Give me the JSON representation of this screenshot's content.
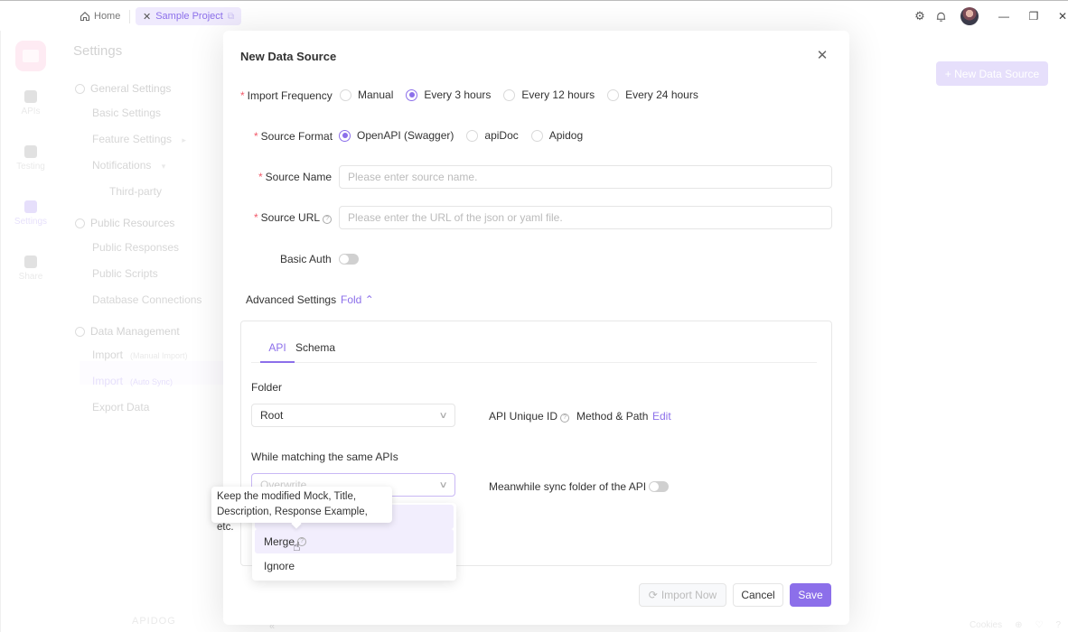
{
  "titlebar": {
    "home_label": "Home",
    "project_tab_label": "Sample Project",
    "icons": [
      "settings-icon",
      "bell-icon",
      "avatar",
      "minimize-icon",
      "restore-icon",
      "close-icon"
    ]
  },
  "rail": {
    "items": [
      {
        "label": "APIs",
        "icon": "apis-icon"
      },
      {
        "label": "Testing",
        "icon": "testing-icon"
      },
      {
        "label": "Settings",
        "icon": "settings-icon",
        "active": true
      },
      {
        "label": "Share",
        "icon": "share-icon"
      }
    ]
  },
  "settings_nav": {
    "title": "Settings",
    "groups": [
      {
        "label": "General Settings",
        "icon": "gear-icon",
        "items": [
          {
            "label": "Basic Settings"
          },
          {
            "label": "Feature Settings",
            "caret": "▸"
          },
          {
            "label": "Notifications",
            "caret": "▾"
          },
          {
            "label": "Third-party"
          }
        ]
      },
      {
        "label": "Public Resources",
        "icon": "layers-icon",
        "items": [
          {
            "label": "Public Responses"
          },
          {
            "label": "Public Scripts"
          },
          {
            "label": "Database Connections"
          }
        ]
      },
      {
        "label": "Data Management",
        "icon": "database-icon",
        "items": [
          {
            "label": "Import",
            "sub": "(Manual Import)"
          },
          {
            "label": "Import",
            "sub": "(Auto Sync)",
            "active": true
          },
          {
            "label": "Export Data"
          }
        ]
      }
    ]
  },
  "background": {
    "new_data_source_button": "+ New Data Source",
    "brand": "APIDOG",
    "footer": {
      "cookies": "Cookies"
    }
  },
  "modal": {
    "title": "New Data Source",
    "import_frequency": {
      "label": "Import Frequency",
      "required": true,
      "options": [
        "Manual",
        "Every 3 hours",
        "Every 12 hours",
        "Every 24 hours"
      ],
      "selected": "Every 3 hours"
    },
    "source_format": {
      "label": "Source Format",
      "required": true,
      "options": [
        "OpenAPI (Swagger)",
        "apiDoc",
        "Apidog"
      ],
      "selected": "OpenAPI (Swagger)"
    },
    "source_name": {
      "label": "Source Name",
      "required": true,
      "value": "",
      "placeholder": "Please enter source name."
    },
    "source_url": {
      "label": "Source URL",
      "required": true,
      "value": "",
      "placeholder": "Please enter the URL of the json or yaml file."
    },
    "basic_auth": {
      "label": "Basic Auth",
      "enabled": false
    },
    "advanced": {
      "label": "Advanced Settings",
      "toggle_label": "Fold",
      "tabs": [
        "API",
        "Schema"
      ],
      "active_tab": "API",
      "folder": {
        "label": "Folder",
        "value": "Root"
      },
      "api_unique_id": {
        "label": "API Unique ID",
        "value": "Method & Path",
        "edit_label": "Edit"
      },
      "matching": {
        "label": "While matching the same APIs",
        "value": "Overwrite"
      },
      "sync_folder": {
        "label": "Meanwhile sync folder of the API",
        "enabled": false
      }
    },
    "dropdown": {
      "options": [
        "Overwrite",
        "Merge",
        "Ignore"
      ],
      "hovered": "Merge",
      "tooltip": "Keep the modified Mock, Title, Description, Response Example, etc."
    },
    "buttons": {
      "import_now": "Import Now",
      "cancel": "Cancel",
      "save": "Save"
    }
  },
  "colors": {
    "accent": "#8c6fea",
    "required": "#f25a6a",
    "accent_light": "#efeafd"
  }
}
